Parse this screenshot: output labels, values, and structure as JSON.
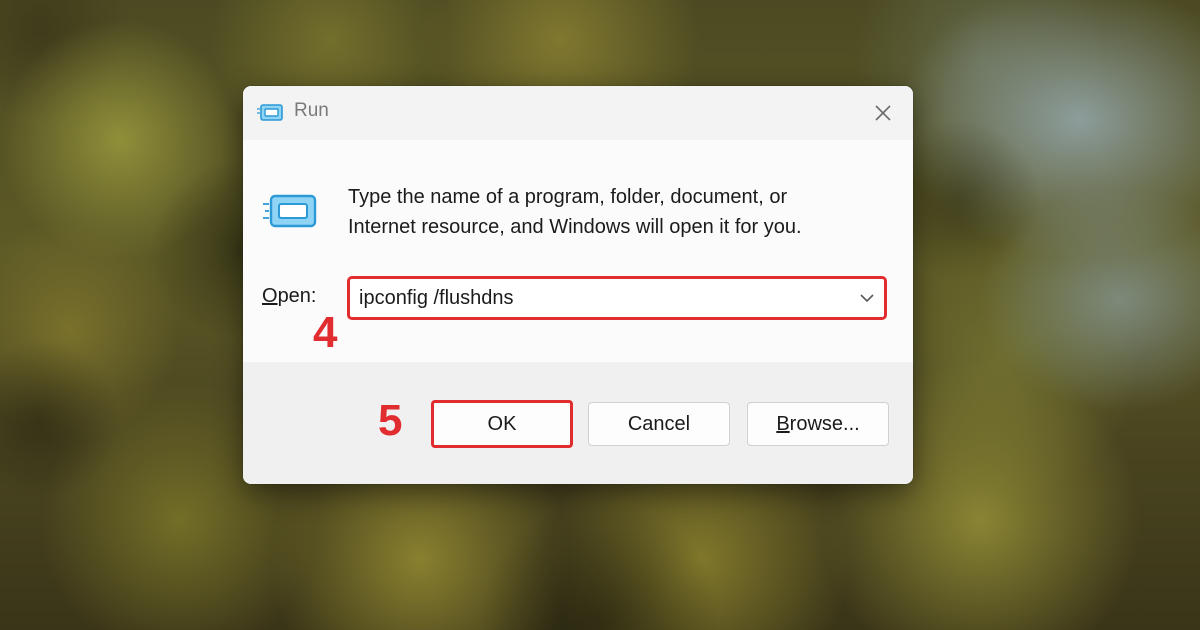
{
  "window": {
    "title": "Run",
    "icon": "run-icon",
    "close_icon": "close-icon"
  },
  "content": {
    "description_line1": "Type the name of a program, folder, document, or",
    "description_line2": "Internet resource, and Windows will open it for you.",
    "open_label_mnemonic": "O",
    "open_label_rest": "pen:",
    "open_value": "ipconfig /flushdns",
    "dropdown_icon": "chevron-down-icon"
  },
  "buttons": {
    "ok": "OK",
    "cancel": "Cancel",
    "browse_mnemonic": "B",
    "browse_rest": "rowse..."
  },
  "annotations": {
    "step_open": "4",
    "step_ok": "5"
  },
  "colors": {
    "highlight": "#e12d30",
    "icon_accent": "#29a3e0"
  }
}
